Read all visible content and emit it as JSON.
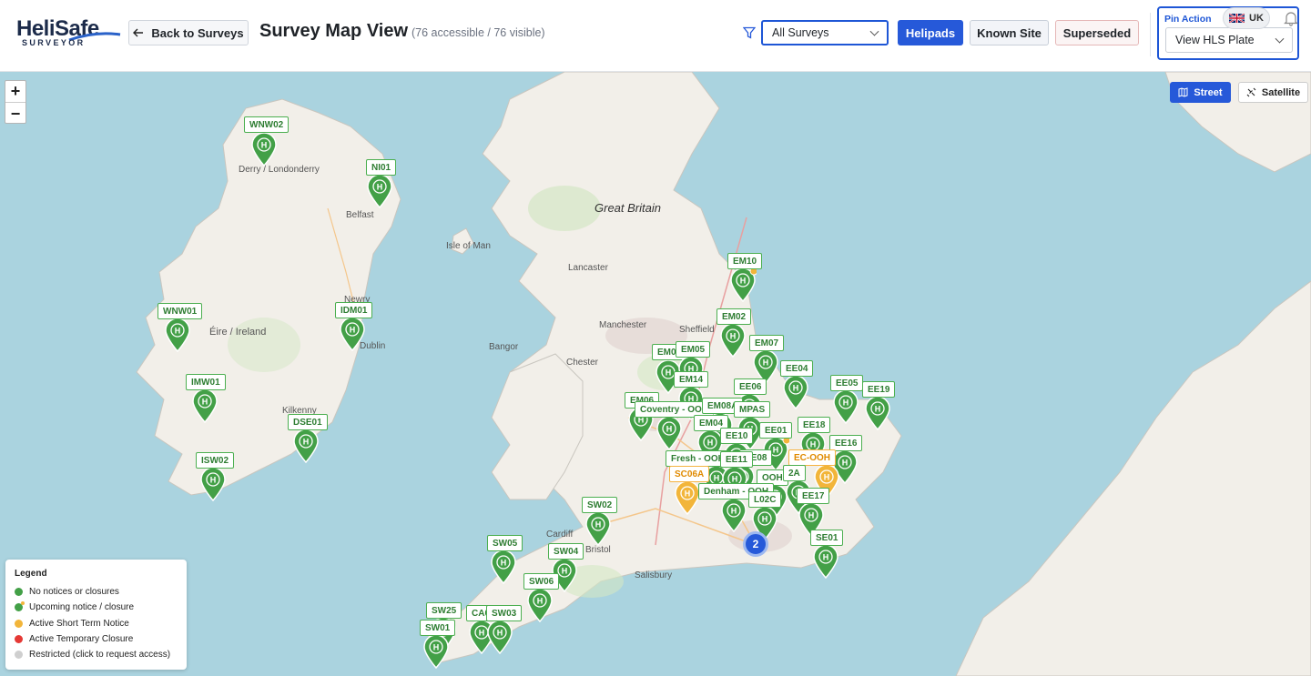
{
  "brand": {
    "name": "HeliSafe",
    "tagline": "SURVEYOR"
  },
  "header": {
    "back_label": "Back to Surveys",
    "title": "Survey Map View",
    "subtitle": "(76 accessible / 76 visible)",
    "survey_filter": "All Surveys",
    "layers": {
      "helipads": "Helipads",
      "known_site": "Known Site",
      "superseded": "Superseded"
    },
    "pin_action": {
      "label": "Pin Action",
      "value": "View HLS Plate"
    },
    "region": "UK"
  },
  "map": {
    "zoom_in": "+",
    "zoom_out": "−",
    "street_label": "Street",
    "satellite_label": "Satellite",
    "labels": {
      "great_britain": "Great Britain",
      "isle_of_man": "Isle of Man",
      "eire": "Éire / Ireland",
      "derry": "Derry / Londonderry",
      "belfast": "Belfast",
      "dublin": "Dublin",
      "manchester": "Manchester",
      "sheffield": "Sheffield",
      "cardiff": "Cardiff",
      "bristol": "Bristol",
      "salisbury": "Salisbury",
      "lancaster": "Lancaster",
      "newry": "Newry",
      "kilkenny": "Kilkenny",
      "bangor": "Bangor",
      "chester": "Chester"
    },
    "cluster_count": "2",
    "pins": [
      {
        "id": "WNW02",
        "status": "green"
      },
      {
        "id": "NI01",
        "status": "green"
      },
      {
        "id": "WNW01",
        "status": "green"
      },
      {
        "id": "IDM01",
        "status": "green"
      },
      {
        "id": "IMW01",
        "status": "green"
      },
      {
        "id": "DSE01",
        "status": "green"
      },
      {
        "id": "ISW02",
        "status": "green"
      },
      {
        "id": "EM10",
        "status": "upcoming"
      },
      {
        "id": "EM02",
        "status": "green"
      },
      {
        "id": "EM07",
        "status": "green"
      },
      {
        "id": "EM01",
        "status": "green"
      },
      {
        "id": "EM05",
        "status": "green"
      },
      {
        "id": "EM14",
        "status": "green"
      },
      {
        "id": "EE04",
        "status": "green"
      },
      {
        "id": "EE05",
        "status": "green"
      },
      {
        "id": "EE19",
        "status": "green"
      },
      {
        "id": "EE06",
        "status": "green"
      },
      {
        "id": "EM06",
        "status": "green"
      },
      {
        "id": "Coventry - OOH",
        "status": "green"
      },
      {
        "id": "EM08A",
        "status": "green"
      },
      {
        "id": "MPAS",
        "status": "green"
      },
      {
        "id": "EM04",
        "status": "green"
      },
      {
        "id": "EE10",
        "status": "green"
      },
      {
        "id": "EE01",
        "status": "upcoming"
      },
      {
        "id": "EE18",
        "status": "green"
      },
      {
        "id": "EE16",
        "status": "green"
      },
      {
        "id": "Fresh - OOH",
        "status": "green"
      },
      {
        "id": "EE08",
        "status": "green"
      },
      {
        "id": "EE11",
        "status": "green"
      },
      {
        "id": "EC-OOH",
        "status": "orange"
      },
      {
        "id": "SC06A",
        "status": "orange"
      },
      {
        "id": "OOH",
        "status": "green"
      },
      {
        "id": "2A",
        "status": "green"
      },
      {
        "id": "Denham - OOH",
        "status": "green"
      },
      {
        "id": "L02C",
        "status": "green"
      },
      {
        "id": "EE17",
        "status": "green"
      },
      {
        "id": "SW02",
        "status": "green"
      },
      {
        "id": "SE01",
        "status": "green"
      },
      {
        "id": "SW05",
        "status": "green"
      },
      {
        "id": "SW04",
        "status": "green"
      },
      {
        "id": "SW06",
        "status": "green"
      },
      {
        "id": "SW25",
        "status": "green"
      },
      {
        "id": "CA01",
        "status": "green"
      },
      {
        "id": "SW03",
        "status": "green"
      },
      {
        "id": "SW01",
        "status": "green"
      }
    ]
  },
  "legend": {
    "title": "Legend",
    "items": [
      {
        "label": "No notices or closures",
        "color": "#43a047"
      },
      {
        "label": "Upcoming notice / closure",
        "color": "#43a047"
      },
      {
        "label": "Active Short Term Notice",
        "color": "#f2b53a"
      },
      {
        "label": "Active Temporary Closure",
        "color": "#e53935"
      },
      {
        "label": "Restricted (click to request access)",
        "color": "#cfcfcf"
      }
    ]
  }
}
